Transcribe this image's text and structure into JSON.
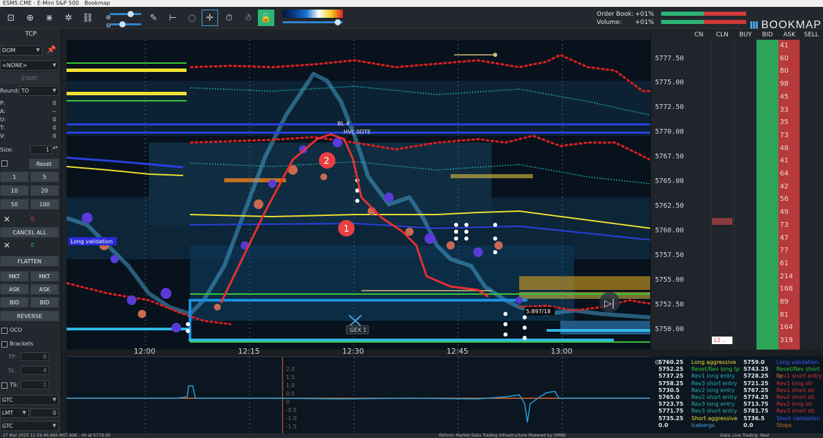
{
  "window": {
    "title": "ESM5.CME - E-Mini S&P 500",
    "app": "Bookmap"
  },
  "toolbar": {
    "order_book_label": "Order Book:",
    "order_book_value": "+01%",
    "volume_label": "Volume:",
    "volume_value": "+01%",
    "brand": "BOOKMAP",
    "icons": [
      "layout-icon",
      "crosshair-icon",
      "network-icon",
      "link-icon",
      "pencil-icon",
      "ruler-icon",
      "chat-icon",
      "cursor-icon",
      "stopwatch-icon",
      "trader-icon",
      "lock-icon"
    ]
  },
  "left_panel": {
    "title": "TCP",
    "account": "DOM",
    "strategy": "<NONE>",
    "start": "START",
    "round_label": "Round:",
    "round_value": "TO",
    "stats": [
      {
        "k": "P:",
        "v": "0"
      },
      {
        "k": "A:",
        "v": "--"
      },
      {
        "k": "U:",
        "v": "0"
      },
      {
        "k": "T:",
        "v": "0"
      },
      {
        "k": "V:",
        "v": "0"
      }
    ],
    "size_label": "Size:",
    "size_value": "1",
    "reset": "Reset",
    "qty_buttons": [
      "1",
      "5",
      "10",
      "20",
      "50",
      "100"
    ],
    "x_value_1": "0",
    "cancel_all": "CANCEL ALL",
    "x_value_2": "0",
    "flatten": "FLATTEN",
    "trade_buttons": [
      "MKT",
      "MKT",
      "ASK",
      "ASK",
      "BID",
      "BID"
    ],
    "reverse": "REVERSE",
    "oco": "OCO",
    "brackets": "Brackets",
    "tp_label": "TP:",
    "tp_value": "6",
    "sl_label": "SL:",
    "sl_value": "4",
    "ts_label": "TS:",
    "ts_value": "1",
    "tif": "GTC",
    "order_type": "LMT",
    "order_qty": "0",
    "tif2": "GTC"
  },
  "chart": {
    "price_labels": [
      "5777.50",
      "5775.00",
      "5772.50",
      "5770.00",
      "5767.50",
      "5765.00",
      "5762.50",
      "5760.00",
      "5757.50",
      "5755.00",
      "5752.50",
      "5750.00"
    ],
    "time_labels": [
      "12:00",
      "12:15",
      "12:30",
      "12:45",
      "13:00"
    ],
    "annotations": {
      "bl4": "BL 4",
      "hvl": "HVL 0DTE",
      "gex": "GEX 1",
      "long_validation": "Long validation",
      "marker1": "1",
      "marker2": "2",
      "trade_tag": "5:897/18"
    }
  },
  "dom": {
    "headers": [
      "CN",
      "CLN",
      "BUY",
      "BID",
      "ASK",
      "SELL"
    ],
    "ask_values": [
      "41",
      "60",
      "80",
      "98",
      "45",
      "33",
      "35",
      "73",
      "48",
      "41",
      "64",
      "42",
      "56",
      "49",
      "73",
      "47",
      "77",
      "61",
      "214",
      "168",
      "89",
      "81",
      "164",
      "319"
    ],
    "l2_tag": "L2 ..",
    "colors": {
      "bid": "#2ea45a",
      "ask": "#b83a3a"
    }
  },
  "indicator": {
    "labels": [
      "2.0",
      "1.5",
      "1.0",
      "0.5",
      "0",
      "-0.5",
      "-1.0",
      "-1.5"
    ]
  },
  "legend": {
    "rows": [
      {
        "p1": "5760.25",
        "l1": "Long aggressive",
        "c1": "#f0e030",
        "p2": "5759.0",
        "l2": "Long validation",
        "c2": "#3a5cff"
      },
      {
        "p1": "5752.25",
        "l1": "Reset/Rev long tp",
        "c1": "#38c838",
        "p2": "5743.25",
        "l2": "Reset/Rev short tp",
        "c2": "#38c838"
      },
      {
        "p1": "5737.25",
        "l1": "Rev1 long entry",
        "c1": "#2ab0b0",
        "p2": "5728.25",
        "l2": "Rev1 short entry",
        "c2": "#e03030"
      },
      {
        "p1": "5758.25",
        "l1": "Rev3 short entry",
        "c1": "#2ab0b0",
        "p2": "5721.25",
        "l2": "Rev1 long str",
        "c2": "#e03030"
      },
      {
        "p1": "5730.5",
        "l1": "Rev2 long entry",
        "c1": "#2ab0b0",
        "p2": "5767.25",
        "l2": "Rev1 short str",
        "c2": "#e03030"
      },
      {
        "p1": "5765.0",
        "l1": "Rev2 short entry",
        "c1": "#2ab0b0",
        "p2": "5774.25",
        "l2": "Rev2 short str",
        "c2": "#e03030"
      },
      {
        "p1": "5723.75",
        "l1": "Rev3 long entry",
        "c1": "#2ab0b0",
        "p2": "5713.75",
        "l2": "Rev2 long str",
        "c2": "#e03030"
      },
      {
        "p1": "5771.75",
        "l1": "Rev3 short entry",
        "c1": "#2ab0b0",
        "p2": "5781.75",
        "l2": "Rev3 short str",
        "c2": "#e03030"
      },
      {
        "p1": "5735.25",
        "l1": "Short aggressive",
        "c1": "#f0e030",
        "p2": "5736.5",
        "l2": "Short validation",
        "c2": "#3a5cff"
      },
      {
        "p1": "0.0",
        "l1": "Icebergs",
        "c1": "#4aa3df",
        "p2": "0.0",
        "l2": "Stops",
        "c2": "#e07020"
      }
    ]
  },
  "status": {
    "left": "27 Mar 2025 11:59:46.666 MST   ASK - 40 at 5778.00",
    "mid": "Rithmic  Market Data Trading Infrastructure   Powered by OMNE",
    "right": "Data: Live   Trading: Real"
  }
}
